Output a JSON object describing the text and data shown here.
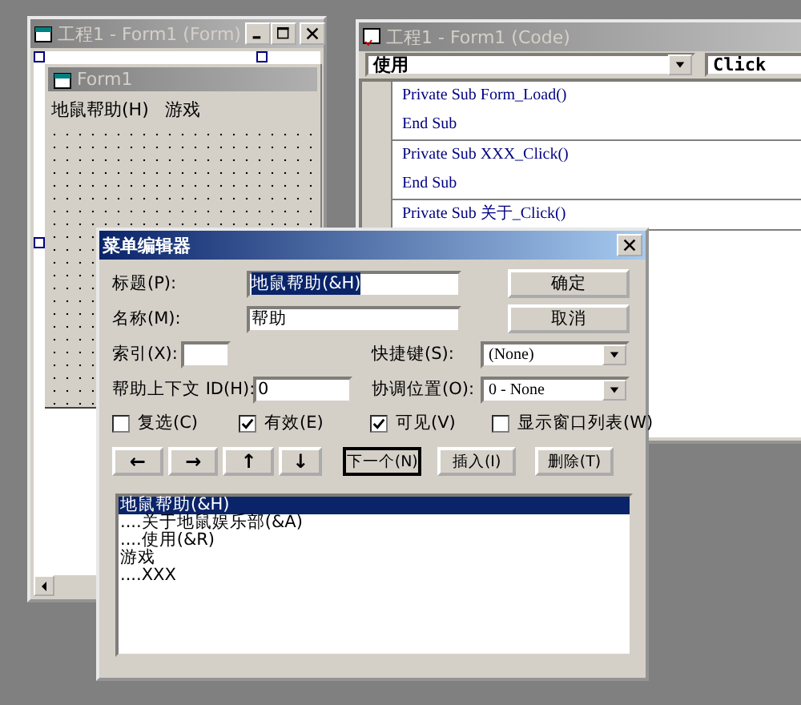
{
  "form_window": {
    "title": "工程1 - Form1 (Form)",
    "form": {
      "title": "Form1",
      "menu": [
        "地鼠帮助(H)",
        "游戏"
      ]
    }
  },
  "code_window": {
    "title": "工程1 - Form1 (Code)",
    "object_combo": "使用",
    "procedure_combo": "Click",
    "procedures": [
      {
        "lines": [
          "Private Sub Form_Load()",
          "End Sub"
        ]
      },
      {
        "lines": [
          "Private Sub XXX_Click()",
          "End Sub"
        ]
      },
      {
        "lines": [
          "Private Sub 关于_Click()"
        ]
      }
    ]
  },
  "dialog": {
    "title": "菜单编辑器",
    "caption": {
      "label": "标题(P):",
      "value": "地鼠帮助(&H)",
      "text_selected": true
    },
    "name": {
      "label": "名称(M):",
      "value": "帮助"
    },
    "index": {
      "label": "索引(X):"
    },
    "shortcut": {
      "label": "快捷键(S):",
      "value": "(None)"
    },
    "help_id": {
      "label": "帮助上下文 ID(H):",
      "value": "0"
    },
    "negotiate": {
      "label": "协调位置(O):",
      "value": "0 - None"
    },
    "ok": "确定",
    "cancel": "取消",
    "checkboxes": [
      {
        "label": "复选(C)",
        "checked": false
      },
      {
        "label": "有效(E)",
        "checked": true
      },
      {
        "label": "可见(V)",
        "checked": true
      },
      {
        "label": "显示窗口列表(W)",
        "checked": false
      }
    ],
    "arrows": [
      "←",
      "→",
      "↑",
      "↓"
    ],
    "actions": [
      {
        "label": "下一个(N)",
        "default": true
      },
      {
        "label": "插入(I)",
        "default": false
      },
      {
        "label": "删除(T)",
        "default": false
      }
    ],
    "menu_items": [
      {
        "label": "地鼠帮助(&H)",
        "selected": true,
        "children": [
          {
            "label": "....关于地鼠娱乐部(&A)",
            "selected": false
          },
          {
            "label": "....使用(&R)",
            "selected": false
          }
        ]
      },
      {
        "label": "游戏",
        "selected": false,
        "children": [
          {
            "label": "....XXX",
            "selected": false
          }
        ]
      }
    ]
  }
}
